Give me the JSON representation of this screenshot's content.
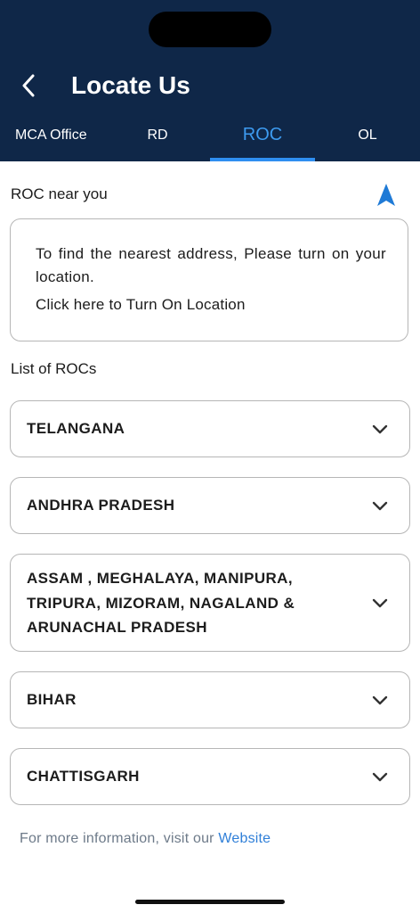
{
  "header": {
    "title": "Locate Us",
    "tabs": [
      "MCA Office",
      "RD",
      "ROC",
      "OL"
    ],
    "active_tab": "ROC"
  },
  "near_you": {
    "title": "ROC near you",
    "message": "To find the nearest address, Please turn on your location.",
    "turn_on_link": "Click here to Turn On Location"
  },
  "list": {
    "title": "List of ROCs",
    "items": [
      "TELANGANA",
      "ANDHRA PRADESH",
      "ASSAM , MEGHALAYA, MANIPURA, TRIPURA, MIZORAM, NAGALAND & ARUNACHAL PRADESH",
      "BIHAR",
      "CHATTISGARH"
    ]
  },
  "footer": {
    "text": "For more information, visit our ",
    "link": "Website"
  },
  "colors": {
    "header_bg": "#0f2748",
    "active_tab": "#3d9bf0",
    "link": "#2f7fd8",
    "nav_icon": "#1f7ad6"
  }
}
